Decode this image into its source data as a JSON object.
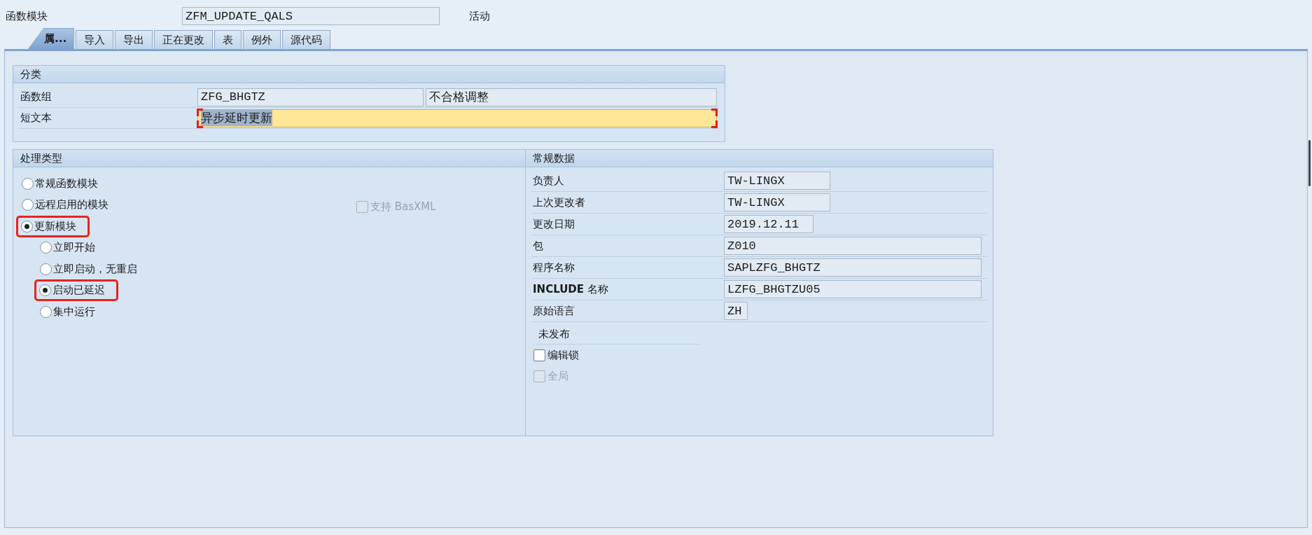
{
  "header": {
    "label": "函数模块",
    "value": "ZFM_UPDATE_QALS",
    "status": "活动"
  },
  "tabs": [
    {
      "label": "属...",
      "selected": true
    },
    {
      "label": "导入",
      "selected": false
    },
    {
      "label": "导出",
      "selected": false
    },
    {
      "label": "正在更改",
      "selected": false
    },
    {
      "label": "表",
      "selected": false
    },
    {
      "label": "例外",
      "selected": false
    },
    {
      "label": "源代码",
      "selected": false
    }
  ],
  "classification": {
    "title": "分类",
    "rows": [
      {
        "label": "函数组",
        "values": [
          "ZFG_BHGTZ",
          "不合格调整"
        ],
        "focused": false
      },
      {
        "label": "短文本",
        "values": [
          "异步延时更新"
        ],
        "focused": true
      }
    ]
  },
  "processing_type": {
    "title": "处理类型",
    "options": [
      {
        "label": "常规函数模块",
        "selected": false,
        "highlighted": false
      },
      {
        "label": "远程启用的模块",
        "selected": false,
        "highlighted": false
      },
      {
        "label": "更新模块",
        "selected": true,
        "highlighted": true,
        "children": [
          {
            "label": "立即开始",
            "selected": false,
            "highlighted": false
          },
          {
            "label": "立即启动，无重启",
            "selected": false,
            "highlighted": false
          },
          {
            "label": "启动已延迟",
            "selected": true,
            "highlighted": true
          },
          {
            "label": "集中运行",
            "selected": false,
            "highlighted": false
          }
        ]
      }
    ],
    "basxml": {
      "label": "支持 BasXML",
      "checked": false,
      "disabled": true
    }
  },
  "general_data": {
    "title": "常规数据",
    "fields": [
      {
        "label": "负责人",
        "value": "TW-LINGX"
      },
      {
        "label": "上次更改者",
        "value": "TW-LINGX"
      },
      {
        "label": "更改日期",
        "value": "2019.12.11"
      },
      {
        "label": "包",
        "value": "Z010"
      },
      {
        "label": "程序名称",
        "value": "SAPLZFG_BHGTZ"
      },
      {
        "label": "**INCLUDE** 名称",
        "value": "LZFG_BHGTZU05"
      },
      {
        "label": "原始语言",
        "value": "ZH"
      }
    ],
    "release": {
      "title": "未发布",
      "checkboxes": [
        {
          "label": "编辑锁",
          "checked": false,
          "disabled": false
        },
        {
          "label": "全局",
          "checked": false,
          "disabled": true
        }
      ]
    }
  }
}
